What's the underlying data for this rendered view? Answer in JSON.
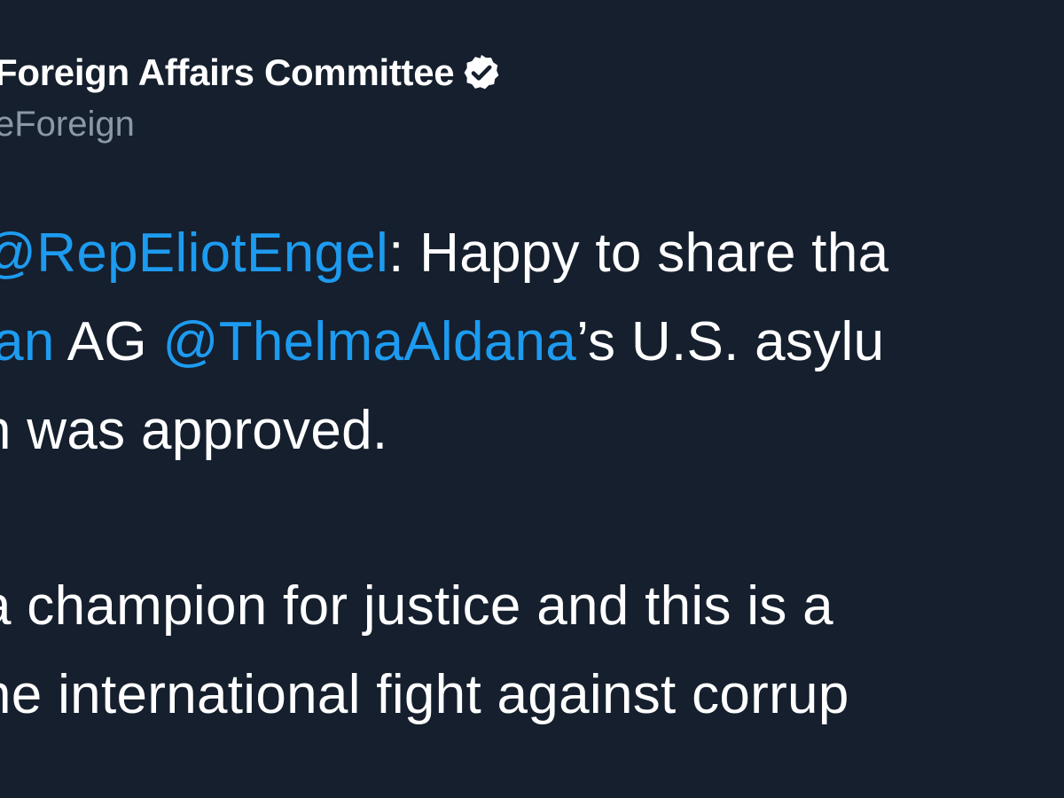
{
  "tweet": {
    "author": {
      "display_name": "Foreign Affairs Committee",
      "handle": "eForeign",
      "verified_icon": "verified-badge-icon"
    },
    "body": {
      "line1": {
        "mention": "@RepEliotEngel",
        "text": ": Happy to share tha"
      },
      "line2": {
        "mention_fragment": "lan",
        "text_ag": " AG ",
        "mention": "@ThelmaAldana",
        "text": "’s U.S. asylu"
      },
      "line3": "n was approved.",
      "line4": "a champion for justice and this is a",
      "line5": "he international fight against corrup"
    }
  },
  "colors": {
    "background": "#151f2d",
    "text": "#ffffff",
    "mention": "#1d9bf0",
    "handle": "#8b98a5"
  }
}
